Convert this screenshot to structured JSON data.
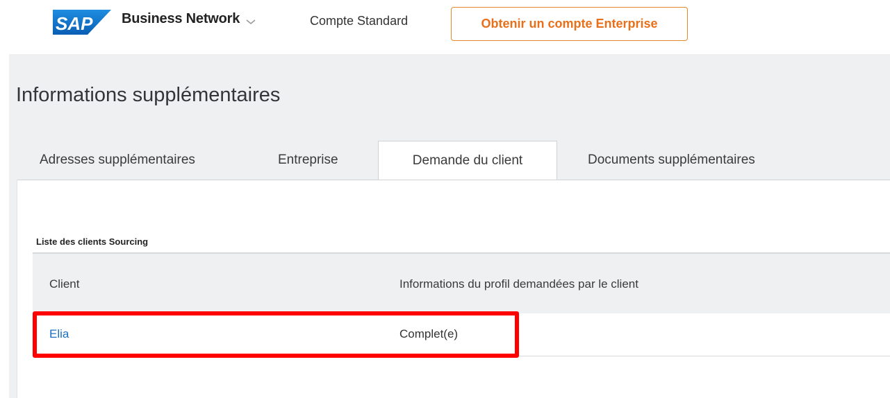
{
  "header": {
    "logo_text": "SAP",
    "product_name": "Business Network",
    "account_type": "Compte Standard",
    "upgrade_button": "Obtenir un compte Enterprise",
    "colors": {
      "logo_blue": "#1a73c8",
      "upgrade_orange": "#e8701a"
    }
  },
  "page": {
    "title": "Informations supplémentaires"
  },
  "tabs": [
    {
      "label": "Adresses supplémentaires",
      "active": false
    },
    {
      "label": "Entreprise",
      "active": false
    },
    {
      "label": "Demande du client",
      "active": true
    },
    {
      "label": "Documents supplémentaires",
      "active": false
    }
  ],
  "section": {
    "label": "Liste des clients Sourcing"
  },
  "table": {
    "columns": [
      "Client",
      "Informations du profil demandées par le client"
    ],
    "rows": [
      {
        "client": "Elia",
        "status": "Complet(e)"
      }
    ]
  },
  "annotation": {
    "color": "#ff0000"
  }
}
